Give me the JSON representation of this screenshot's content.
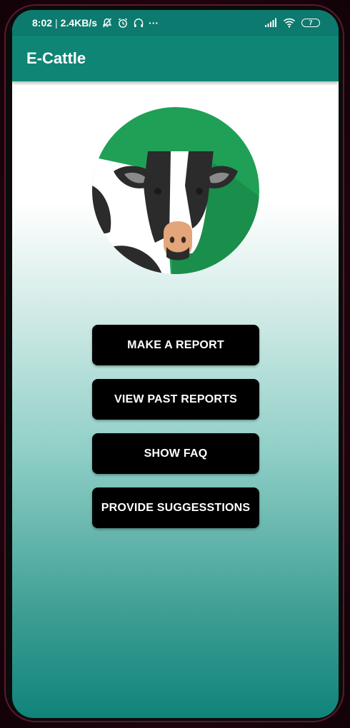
{
  "status_bar": {
    "time": "8:02",
    "separator": "|",
    "network_speed": "2.4KB/s",
    "more": "···",
    "battery": "7",
    "icons_left": [
      "mute-icon",
      "alarm-icon",
      "headphones-icon"
    ],
    "icons_right": [
      "signal-icon",
      "wifi-icon",
      "battery-icon"
    ]
  },
  "app_bar": {
    "title": "E-Cattle",
    "color": "#0f8576"
  },
  "logo": {
    "icon": "cow-logo-icon",
    "circle_color": "#1fa056"
  },
  "menu": {
    "make_report": "MAKE A REPORT",
    "view_past_reports": "VIEW PAST REPORTS",
    "show_faq": "SHOW FAQ",
    "provide_suggestions": "PROVIDE SUGGESSTIONS"
  }
}
